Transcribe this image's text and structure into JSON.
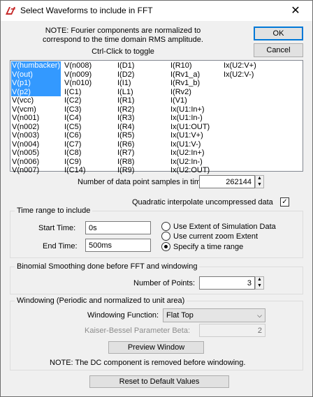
{
  "window": {
    "title": "Select Waveforms to include in FFT",
    "close_glyph": "✕"
  },
  "note_top": "NOTE:  Fourier components are normalized to correspond to the time domain RMS amplitude.",
  "hint": "Ctrl-Click to toggle",
  "buttons": {
    "ok": "OK",
    "cancel": "Cancel",
    "preview": "Preview Window",
    "reset": "Reset to Default Values"
  },
  "waveforms": {
    "col1": [
      {
        "label": "V(humbacker)",
        "selected": true
      },
      {
        "label": "V(out)",
        "selected": true
      },
      {
        "label": "V(p1)",
        "selected": true
      },
      {
        "label": "V(p2)",
        "selected": true
      },
      {
        "label": "V(vcc)",
        "selected": false
      },
      {
        "label": "V(vcm)",
        "selected": false
      },
      {
        "label": "V(n001)",
        "selected": false
      },
      {
        "label": "V(n002)",
        "selected": false
      },
      {
        "label": "V(n003)",
        "selected": false
      },
      {
        "label": "V(n004)",
        "selected": false
      },
      {
        "label": "V(n005)",
        "selected": false
      },
      {
        "label": "V(n006)",
        "selected": false
      },
      {
        "label": "V(n007)",
        "selected": false
      }
    ],
    "col2": [
      "V(n008)",
      "V(n009)",
      "V(n010)",
      "I(C1)",
      "I(C2)",
      "I(C3)",
      "I(C4)",
      "I(C5)",
      "I(C6)",
      "I(C7)",
      "I(C8)",
      "I(C9)",
      "I(C14)"
    ],
    "col3": [
      "I(D1)",
      "I(D2)",
      "I(I1)",
      "I(L1)",
      "I(R1)",
      "I(R2)",
      "I(R3)",
      "I(R4)",
      "I(R5)",
      "I(R6)",
      "I(R7)",
      "I(R8)",
      "I(R9)"
    ],
    "col4": [
      "I(R10)",
      "I(Rv1_a)",
      "I(Rv1_b)",
      "I(Rv2)",
      "I(V1)",
      "Ix(U1:In+)",
      "Ix(U1:In-)",
      "Ix(U1:OUT)",
      "Ix(U1:V+)",
      "Ix(U1:V-)",
      "Ix(U2:In+)",
      "Ix(U2:In-)",
      "Ix(U2:OUT)"
    ],
    "col5": [
      "Ix(U2:V+)",
      "Ix(U2:V-)"
    ]
  },
  "samples": {
    "label": "Number of data point samples in time:",
    "value": "262144"
  },
  "quadratic": {
    "label": "Quadratic interpolate uncompressed data",
    "checked": true,
    "check_glyph": "✓"
  },
  "time_range": {
    "title": "Time range to include",
    "start_label": "Start Time:",
    "start_value": "0s",
    "end_label": "End Time:",
    "end_value": "500ms",
    "opt_extent": "Use Extent of Simulation Data",
    "opt_zoom": "Use current zoom Extent",
    "opt_specify": "Specify a time range",
    "selected": "specify"
  },
  "smoothing": {
    "title": "Binomial Smoothing done before FFT and windowing",
    "points_label": "Number of Points:",
    "points_value": "3"
  },
  "windowing": {
    "title": "Windowing  (Periodic and normalized to unit area)",
    "function_label": "Windowing Function:",
    "function_value": "Flat Top",
    "beta_label": "Kaiser-Bessel Parameter Beta:",
    "beta_value": "2",
    "note": "NOTE:  The DC component is removed before windowing."
  },
  "spin_up": "▲",
  "spin_down": "▼",
  "dropdown_arrow": "⌵",
  "colors": {
    "selection": "#3399ff",
    "default_button_border": "#0078d7",
    "logo_red": "#c62828"
  }
}
